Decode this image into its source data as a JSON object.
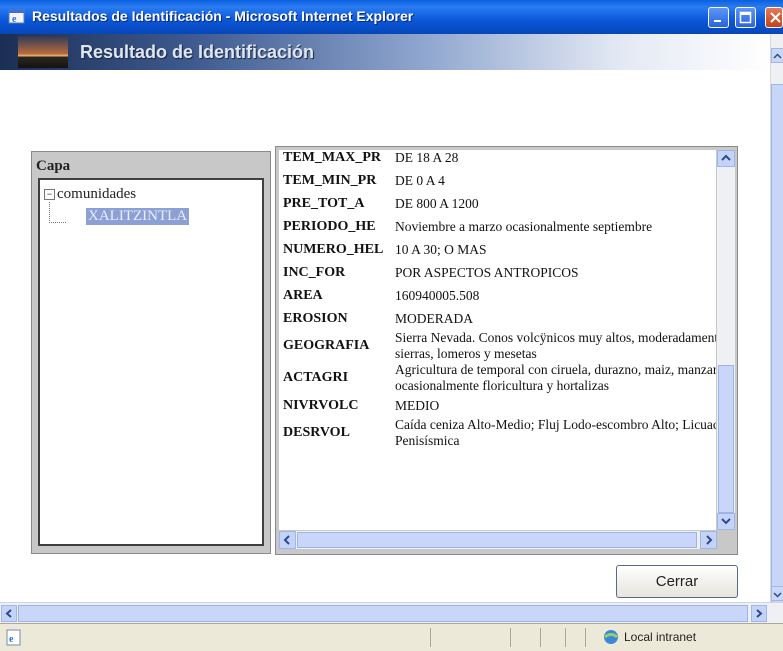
{
  "window": {
    "title": "Resultados de Identificación - Microsoft Internet Explorer"
  },
  "banner": {
    "title": "Resultado de Identificación"
  },
  "capa": {
    "header": "Capa",
    "tree": {
      "root": "comunidades",
      "child": "XALITZINTLA"
    }
  },
  "attributes": [
    {
      "key": "TEM_MAX_PR",
      "value": "DE 18 A 28"
    },
    {
      "key": "TEM_MIN_PR",
      "value": "DE 0 A 4"
    },
    {
      "key": "PRE_TOT_A",
      "value": "DE 800 A 1200"
    },
    {
      "key": "PERIODO_HE",
      "value": "Noviembre a marzo ocasionalmente septiembre"
    },
    {
      "key": "NUMERO_HEL",
      "value": "10 A 30; O MAS"
    },
    {
      "key": "INC_FOR",
      "value": "POR ASPECTOS ANTROPICOS"
    },
    {
      "key": "AREA",
      "value": "160940005.508"
    },
    {
      "key": "EROSION",
      "value": "MODERADA"
    },
    {
      "key": "GEOGRAFIA",
      "value": "Sierra Nevada. Conos volcÿnicos muy altos, moderadamente erosionados, sierras, lomeros y mesetas"
    },
    {
      "key": "ACTAGRI",
      "value": "Agricultura de temporal con ciruela, durazno, maiz, manzana y pera; ocasionalmente floricultura y hortalizas"
    },
    {
      "key": "NIVRVOLC",
      "value": "MEDIO"
    },
    {
      "key": "DESRVOL",
      "value": "Caída ceniza Alto-Medio; Fluj Lodo-escombro Alto; Licuación Medio; Zona Penisísmica"
    }
  ],
  "buttons": {
    "close": "Cerrar"
  },
  "status": {
    "zone": "Local intranet"
  }
}
